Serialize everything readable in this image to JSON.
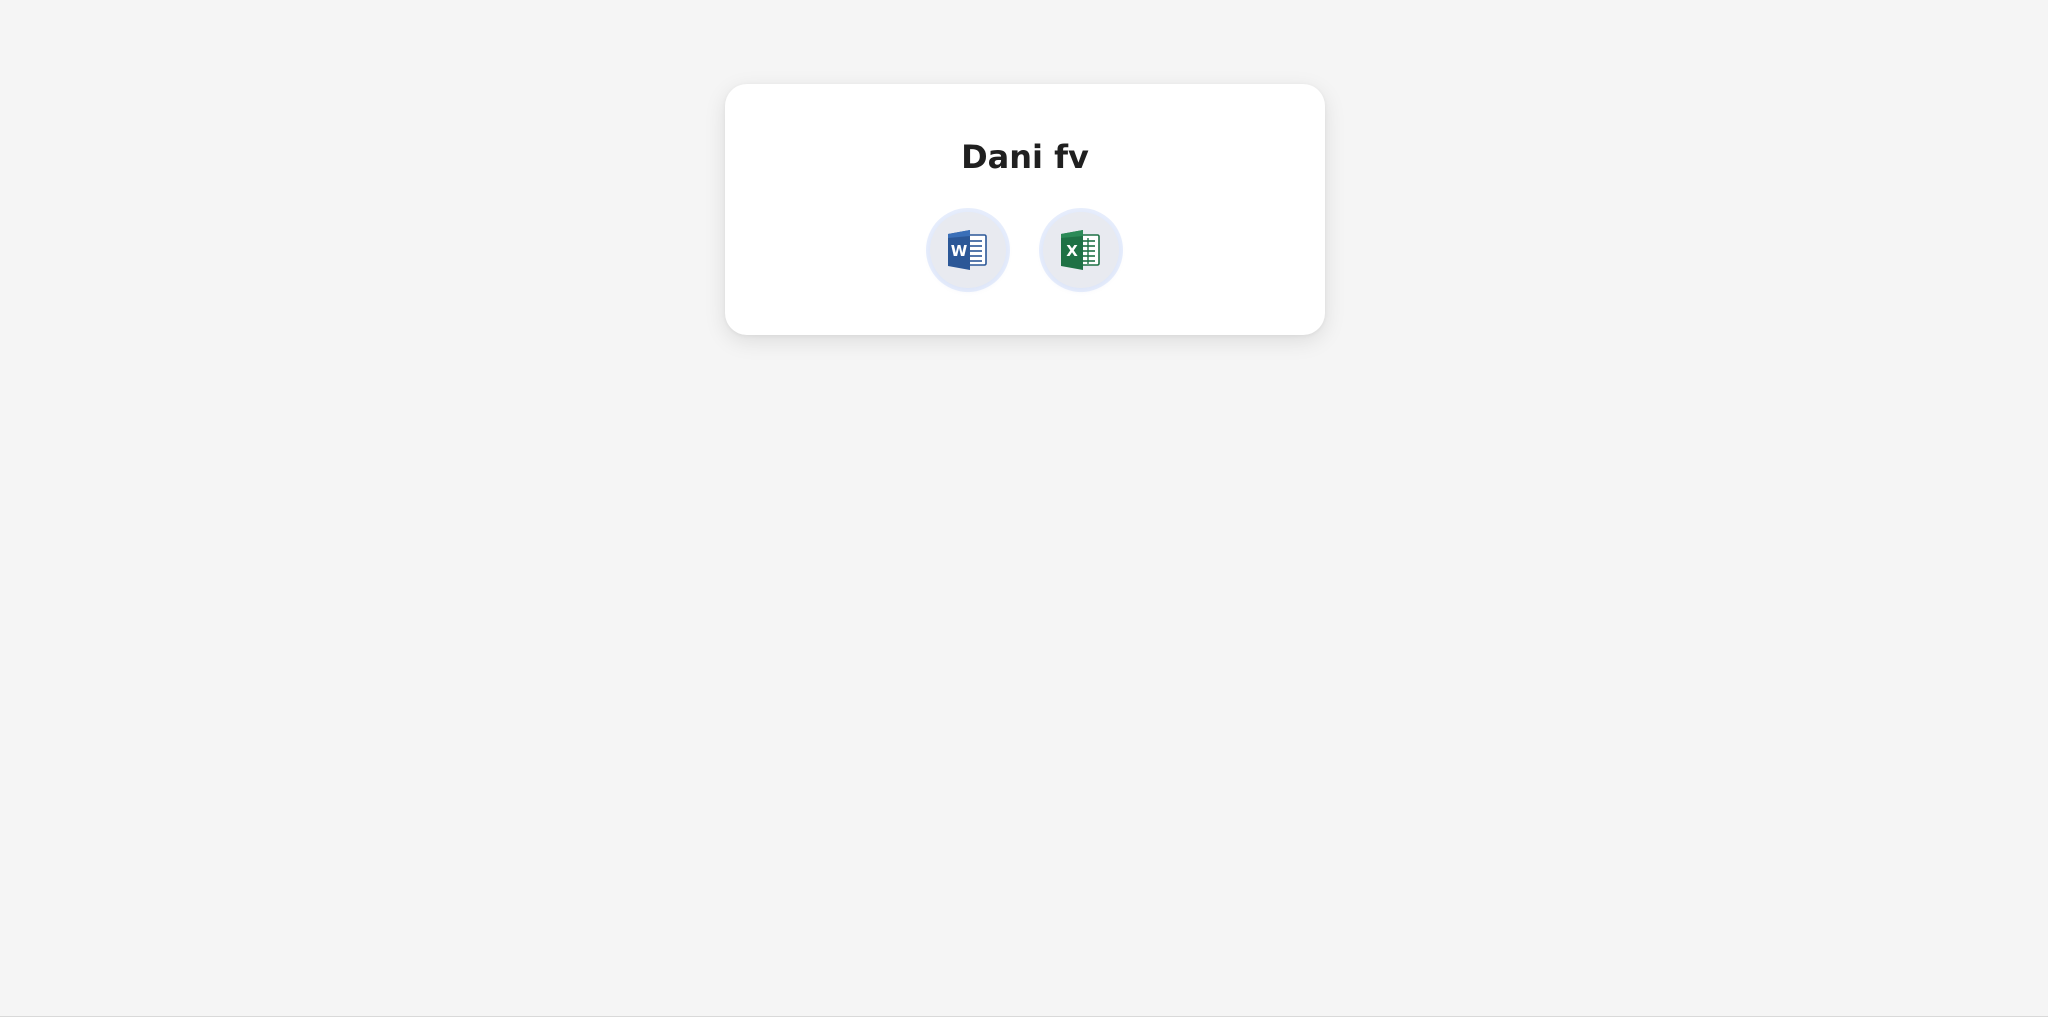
{
  "card": {
    "title": "Dani fv"
  },
  "apps": [
    {
      "icon": "word-icon",
      "letter": "W",
      "color": "#2b5797"
    },
    {
      "icon": "excel-icon",
      "letter": "X",
      "color": "#1e7145"
    }
  ],
  "colors": {
    "page_background": "#f5f5f5",
    "card_background": "#ffffff",
    "title_text": "#202020",
    "word_brand": "#2b5797",
    "excel_brand": "#1e7145"
  }
}
